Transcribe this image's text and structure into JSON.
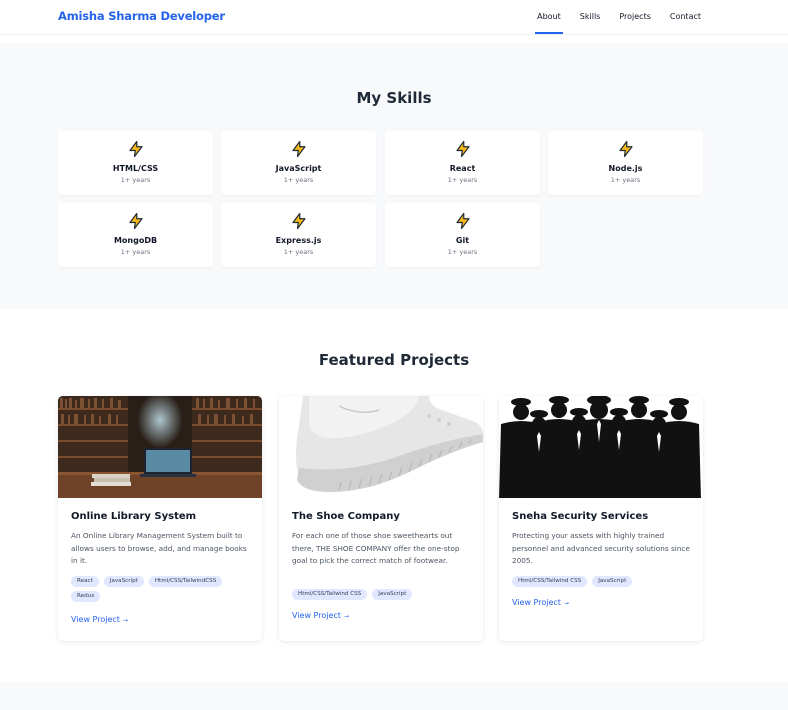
{
  "header": {
    "brand": "Amisha Sharma Developer",
    "nav": [
      "About",
      "Skills",
      "Projects",
      "Contact"
    ]
  },
  "skills": {
    "title": "My Skills",
    "items": [
      {
        "name": "HTML/CSS",
        "experience": "1+ years"
      },
      {
        "name": "JavaScript",
        "experience": "1+ years"
      },
      {
        "name": "React",
        "experience": "1+ years"
      },
      {
        "name": "Node.js",
        "experience": "1+ years"
      },
      {
        "name": "MongoDB",
        "experience": "1+ years"
      },
      {
        "name": "Express.js",
        "experience": "1+ years"
      },
      {
        "name": "Git",
        "experience": "1+ years"
      }
    ],
    "icon": "lightning-bolt-icon"
  },
  "projects": {
    "title": "Featured Projects",
    "items": [
      {
        "name": "Online Library System",
        "description": "An Online Library Management System built to allows users to browse, add, and manage books in it.",
        "tags": [
          "React",
          "JavaScript",
          "Html/CSS/TailwindCSS",
          "Redux"
        ],
        "link": "View Project",
        "image": "library-bookshelves-image"
      },
      {
        "name": "The Shoe Company",
        "description": "For each one of those shoe sweethearts out there, THE SHOE COMPANY offer the one-stop goal to pick the correct match of footwear.",
        "tags": [
          "Html/CSS/Tailwind CSS",
          "JavaScript"
        ],
        "link": "View Project",
        "image": "white-sneaker-image"
      },
      {
        "name": "Sneha Security Services",
        "description": "Protecting your assets with highly trained personnel and advanced security solutions since 2005.",
        "tags": [
          "Html/CSS/Tailwind CSS",
          "JavaScript"
        ],
        "link": "View Project",
        "image": "security-guards-silhouette-image"
      }
    ],
    "arrow": "→"
  },
  "colors": {
    "accent": "#2563eb",
    "bolt": "#f5b919",
    "section_bg": "#f8f9fb"
  }
}
